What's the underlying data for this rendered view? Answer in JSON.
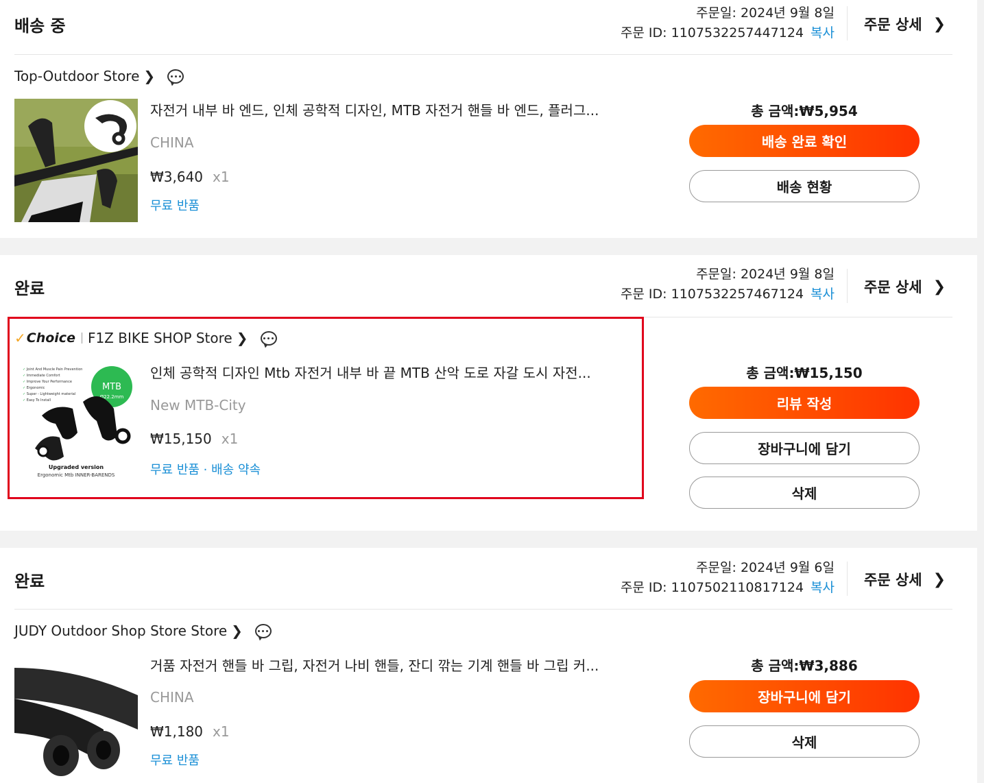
{
  "orders": [
    {
      "status": "배송 중",
      "order_date": "주문일: 2024년 9월 8일",
      "order_id": "주문 ID: 1107532257447124",
      "copy_label": "복사",
      "detail_label": "주문 상세",
      "store": "Top-Outdoor Store",
      "product_title": "자전거 내부 바 엔드, 인체 공학적 디자인, MTB 자전거 핸들 바 엔드, 플러그...",
      "variant": "CHINA",
      "price": "₩3,640",
      "qty": "x1",
      "note": "무료 반품",
      "total": "총 금액:₩5,954",
      "buttons": [
        "배송 완료 확인",
        "배송 현황"
      ]
    },
    {
      "status": "완료",
      "order_date": "주문일: 2024년 9월 8일",
      "order_id": "주문 ID: 1107532257467124",
      "copy_label": "복사",
      "detail_label": "주문 상세",
      "choice_label": "Choice",
      "store": "F1Z BIKE SHOP Store",
      "product_title": "인체 공학적 디자인 Mtb 자전거 내부 바 끝 MTB 산악 도로 자갈 도시 자전...",
      "variant": "New MTB-City",
      "price": "₩15,150",
      "qty": "x1",
      "note": "무료 반품 · 배송 약속",
      "total": "총 금액:₩15,150",
      "buttons": [
        "리뷰 작성",
        "장바구니에 담기",
        "삭제"
      ],
      "thumb_text": {
        "features": [
          "Joint And Muscle Pain Prevention",
          "Immediate Comfort",
          "Improve Your Performance",
          "Ergonomic",
          "Super - Lightweight material",
          "Easy To Install"
        ],
        "badge_top": "MTB",
        "badge_bottom": "Ø22.2mm",
        "caption1": "Upgraded version",
        "caption2": "Ergonomic Mtb INNER-BARENDS"
      }
    },
    {
      "status": "완료",
      "order_date": "주문일: 2024년 9월 6일",
      "order_id": "주문 ID: 1107502110817124",
      "copy_label": "복사",
      "detail_label": "주문 상세",
      "store": "JUDY Outdoor Shop Store Store",
      "product_title": "거품 자전거 핸들 바 그립, 자전거 나비 핸들, 잔디 깎는 기계 핸들 바 그립 커...",
      "variant": "CHINA",
      "price": "₩1,180",
      "qty": "x1",
      "note": "무료 반품",
      "total": "총 금액:₩3,886",
      "buttons": [
        "장바구니에 담기",
        "삭제"
      ]
    }
  ],
  "colors": {
    "accent_start": "#ff6a00",
    "accent_end": "#ff3300",
    "link": "#1a8fd6",
    "highlight": "#e0001b",
    "choice_check": "#f5a623"
  }
}
